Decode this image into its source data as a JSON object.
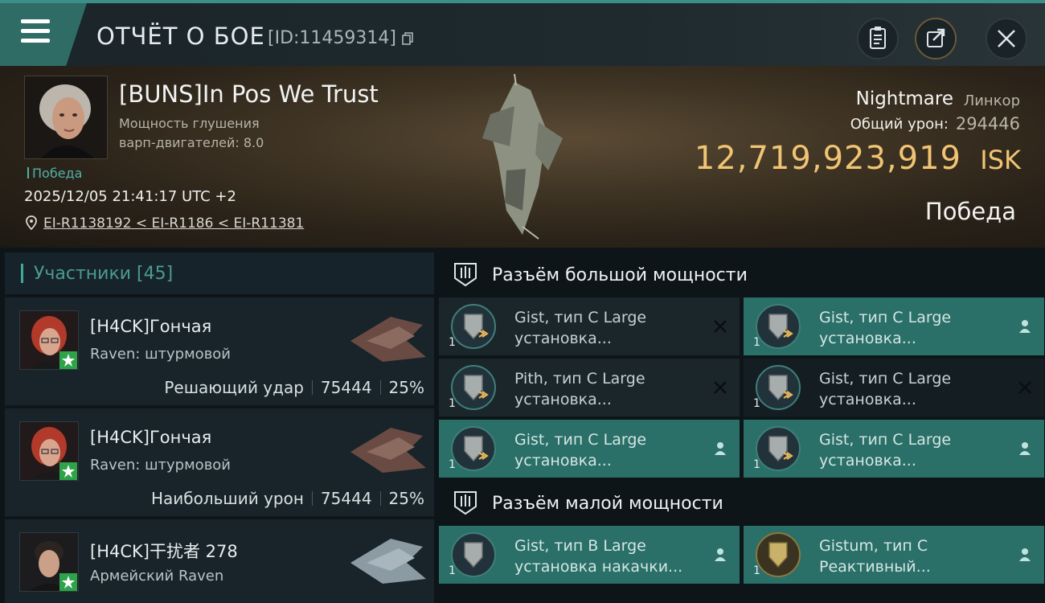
{
  "header": {
    "title": "ОТЧЁТ О БОЕ",
    "report_id": "[ID:11459314]"
  },
  "victim": {
    "name": "[BUNS]In Pos We Trust",
    "stat_line1": "Мощность глушения",
    "stat_line2": "варп-двигателей: 8.0",
    "status_tag": "Победа",
    "datetime": "2025/12/05 21:41:17 UTC +2",
    "location": "EI-R1138192 < EI-R1186 < EI-R11381",
    "ship_name": "Nightmare",
    "ship_class": "Линкор",
    "total_damage_label": "Общий урон:",
    "total_damage": "294446",
    "isk_value": "12,719,923,919",
    "isk_unit": "ISK",
    "result": "Победа"
  },
  "participants": {
    "title": "Участники [45]",
    "items": [
      {
        "name": "[H4CK]Гончая",
        "ship": "Raven: штурмовой",
        "role": "Решающий удар",
        "damage": "75444",
        "percent": "25%"
      },
      {
        "name": "[H4CK]Гончая",
        "ship": "Raven: штурмовой",
        "role": "Наибольший урон",
        "damage": "75444",
        "percent": "25%"
      },
      {
        "name": "[H4CK]干扰者 278",
        "ship": "Армейский Raven",
        "role": "",
        "damage": "",
        "percent": ""
      }
    ]
  },
  "high_slots": {
    "title": "Разъём большой мощности",
    "items": [
      {
        "name": "Gist, тип C Large",
        "sub": "установка...",
        "qty": "1",
        "status": "destroyed"
      },
      {
        "name": "Gist, тип C Large",
        "sub": "установка...",
        "qty": "1",
        "status": "dropped"
      },
      {
        "name": "Pith, тип C Large",
        "sub": "установка...",
        "qty": "1",
        "status": "destroyed"
      },
      {
        "name": "Gist, тип C Large",
        "sub": "установка...",
        "qty": "1",
        "status": "destroyed"
      },
      {
        "name": "Gist, тип C Large",
        "sub": "установка...",
        "qty": "1",
        "status": "dropped"
      },
      {
        "name": "Gist, тип C Large",
        "sub": "установка...",
        "qty": "1",
        "status": "dropped"
      }
    ]
  },
  "low_slots": {
    "title": "Разъём малой мощности",
    "items": [
      {
        "name": "Gist, тип B Large",
        "sub": "установка накачки...",
        "qty": "1",
        "status": "dropped"
      },
      {
        "name": "Gistum, тип C",
        "sub": "Реактивный...",
        "qty": "1",
        "status": "dropped"
      }
    ]
  },
  "colors": {
    "accent_teal": "#3b8f86",
    "isk_gold": "#f0c473",
    "fitted_slot": "#2a6f68"
  }
}
